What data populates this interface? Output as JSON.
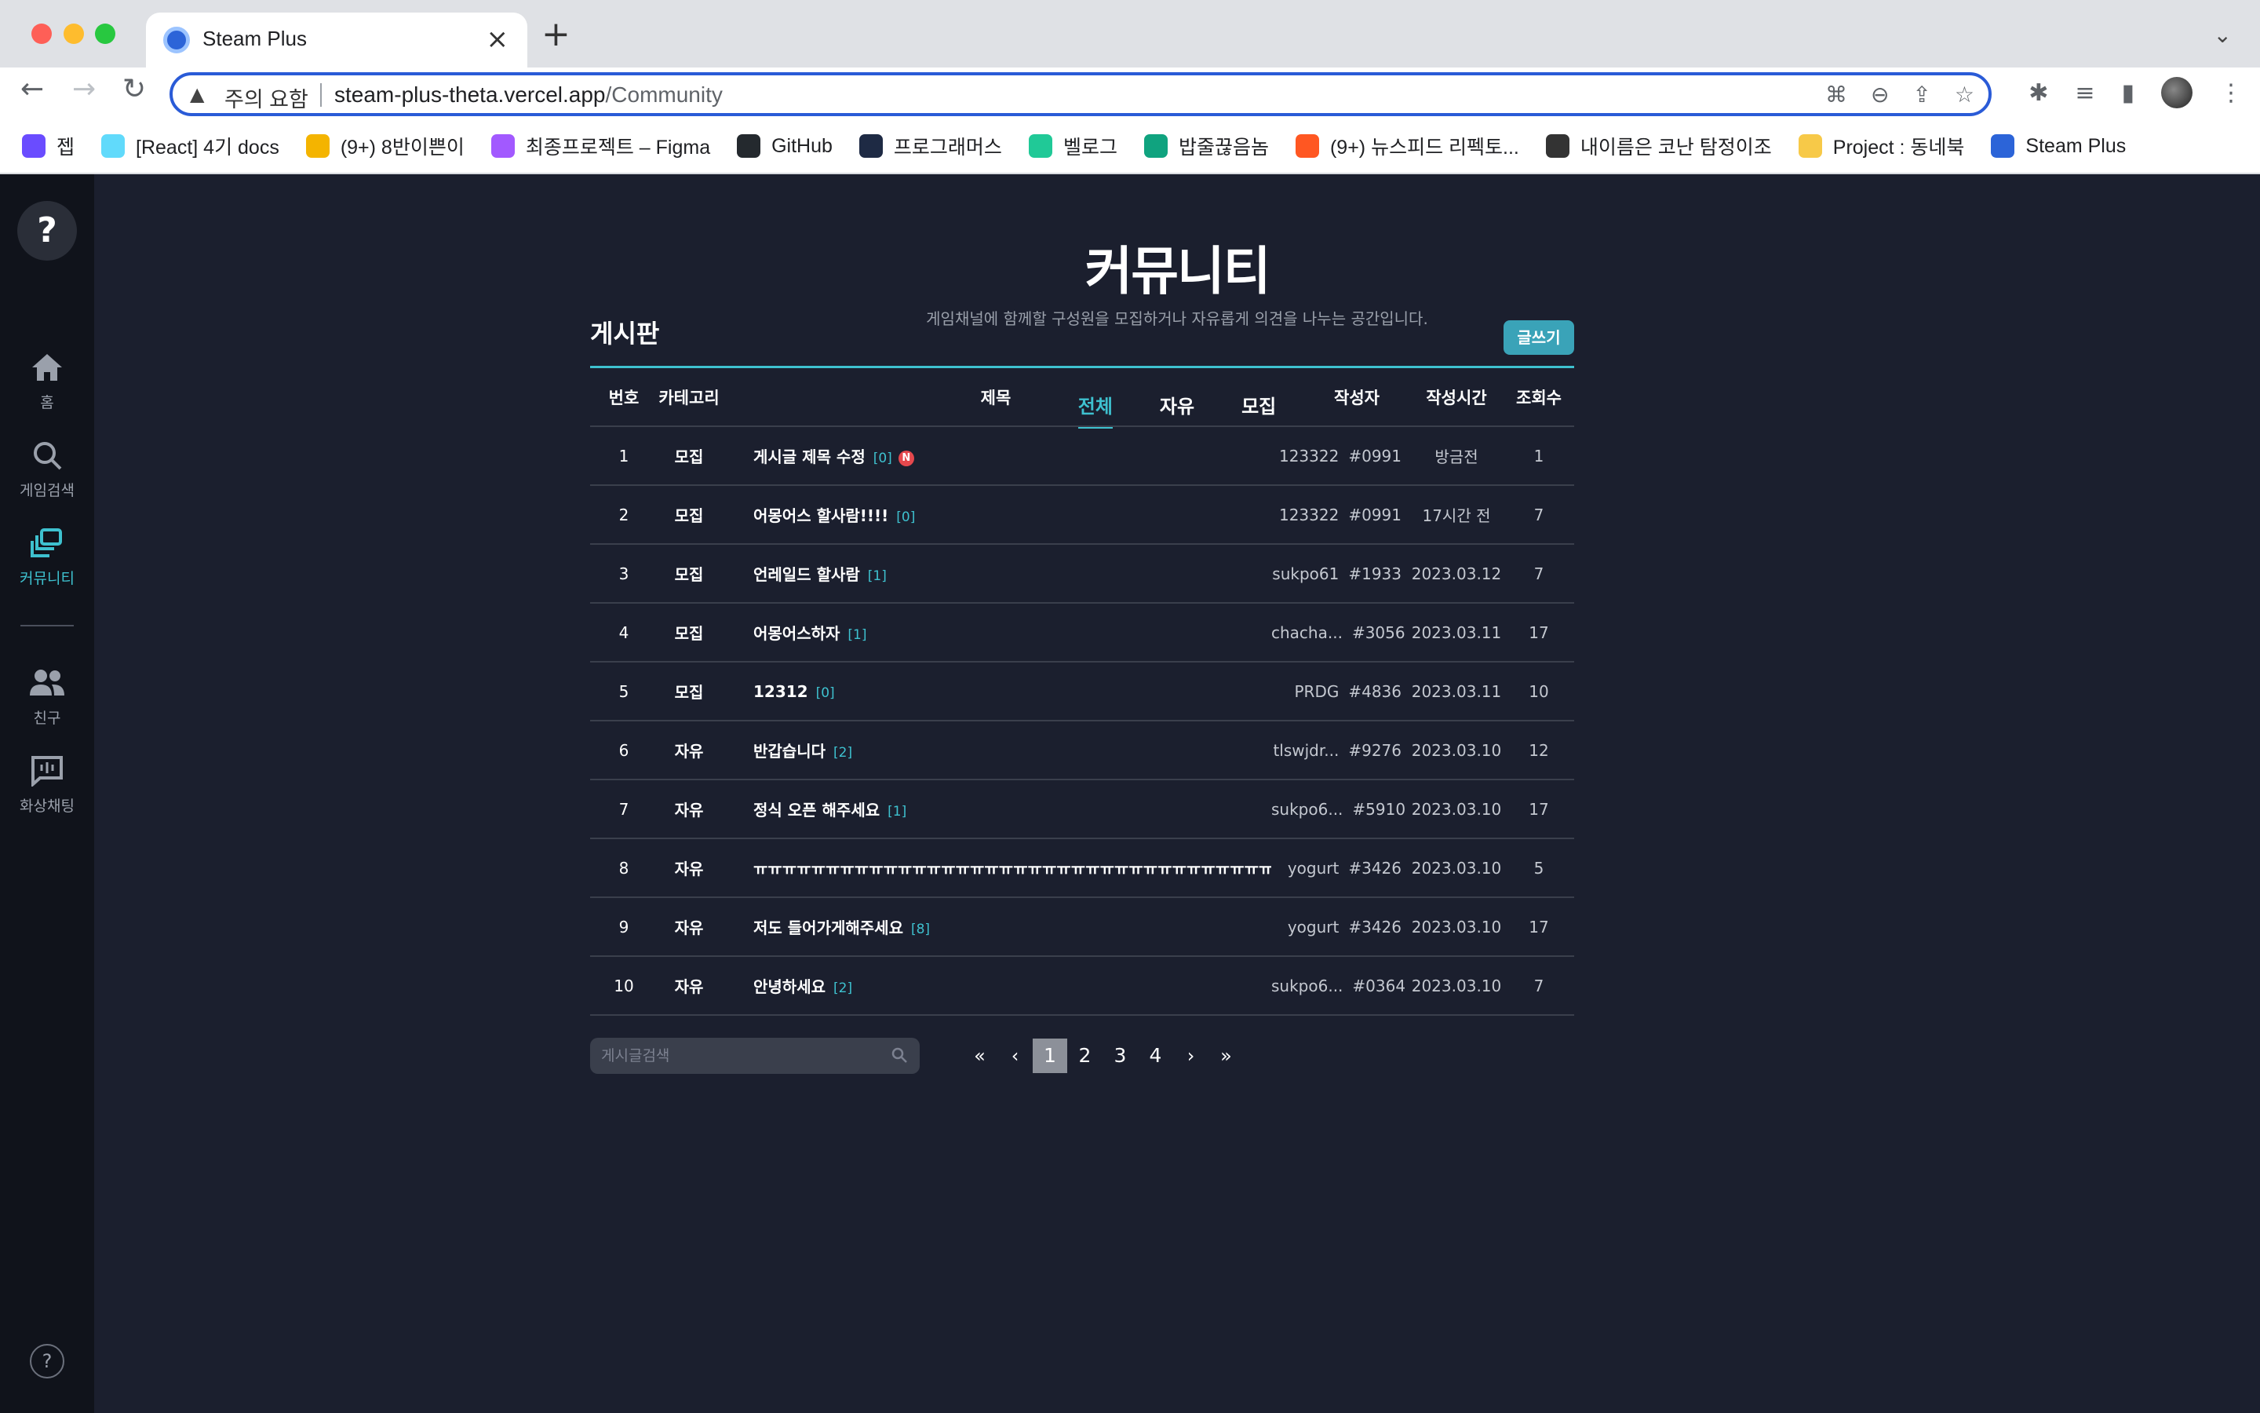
{
  "browser": {
    "tab_title": "Steam Plus",
    "security_warning": "주의 요함",
    "url_domain": "steam-plus-theta.vercel.app",
    "url_path": "/Community",
    "bookmarks": [
      {
        "label": "젭",
        "color": "#6a4cff",
        "icon": "zep-icon"
      },
      {
        "label": "[React] 4기 docs",
        "color": "#61dafb",
        "icon": "react-icon"
      },
      {
        "label": "(9+) 8반이쁜이",
        "color": "#f4b400",
        "icon": "emoji-icon"
      },
      {
        "label": "최종프로젝트 – Figma",
        "color": "#a259ff",
        "icon": "figma-icon"
      },
      {
        "label": "GitHub",
        "color": "#24292e",
        "icon": "github-icon"
      },
      {
        "label": "프로그래머스",
        "color": "#1e2a44",
        "icon": "programmers-icon"
      },
      {
        "label": "벨로그",
        "color": "#20c997",
        "icon": "velog-icon"
      },
      {
        "label": "밥줄끊음놈",
        "color": "#10a37f",
        "icon": "chatgpt-icon"
      },
      {
        "label": "(9+) 뉴스피드 리펙토...",
        "color": "#ff5722",
        "icon": "fire-icon"
      },
      {
        "label": "내이름은 코난 탐정이조",
        "color": "#333333",
        "icon": "watch-icon"
      },
      {
        "label": "Project : 동네북",
        "color": "#f7c948",
        "icon": "banana-icon"
      },
      {
        "label": "Steam Plus",
        "color": "#2c64d8",
        "icon": "steam-plus-icon"
      }
    ]
  },
  "sidebar": {
    "items": [
      {
        "label": "홈",
        "icon": "home-icon"
      },
      {
        "label": "게임검색",
        "icon": "search-icon"
      },
      {
        "label": "커뮤니티",
        "icon": "community-icon",
        "active": true
      },
      {
        "label": "친구",
        "icon": "friends-icon"
      },
      {
        "label": "화상채팅",
        "icon": "video-chat-icon"
      }
    ],
    "help": "?"
  },
  "page": {
    "title": "커뮤니티",
    "description": "게임채널에 함께할 구성원을 모집하거나 자유롭게 의견을 나누는 공간입니다.",
    "tabs": [
      "전체",
      "자유",
      "모집"
    ],
    "active_tab": "전체"
  },
  "board": {
    "title": "게시판",
    "write_label": "글쓰기",
    "columns": [
      "번호",
      "카테고리",
      "제목",
      "작성자",
      "작성시간",
      "조회수"
    ],
    "rows": [
      {
        "no": "1",
        "category": "모집",
        "title": "게시글 제목 수정",
        "comments": "[0]",
        "new": "N",
        "author": "123322",
        "tag": "#0991",
        "time": "방금전",
        "views": "1"
      },
      {
        "no": "2",
        "category": "모집",
        "title": "어몽어스 할사람!!!!",
        "comments": "[0]",
        "author": "123322",
        "tag": "#0991",
        "time": "17시간 전",
        "views": "7"
      },
      {
        "no": "3",
        "category": "모집",
        "title": "언레일드 할사람",
        "comments": "[1]",
        "author": "sukpo61",
        "tag": "#1933",
        "time": "2023.03.12",
        "views": "7"
      },
      {
        "no": "4",
        "category": "모집",
        "title": "어몽어스하자",
        "comments": "[1]",
        "author": "chacha...",
        "tag": "#3056",
        "time": "2023.03.11",
        "views": "17"
      },
      {
        "no": "5",
        "category": "모집",
        "title": "12312",
        "comments": "[0]",
        "author": "PRDG",
        "tag": "#4836",
        "time": "2023.03.11",
        "views": "10"
      },
      {
        "no": "6",
        "category": "자유",
        "title": "반갑습니다",
        "comments": "[2]",
        "author": "tlswjdr...",
        "tag": "#9276",
        "time": "2023.03.10",
        "views": "12"
      },
      {
        "no": "7",
        "category": "자유",
        "title": "정식 오픈 해주세요",
        "comments": "[1]",
        "author": "sukpo6...",
        "tag": "#5910",
        "time": "2023.03.10",
        "views": "17"
      },
      {
        "no": "8",
        "category": "자유",
        "title": "ㅠㅠㅠㅠㅠㅠㅠㅠㅠㅠㅠㅠㅠㅠㅠㅠㅠㅠㅠㅠㅠㅠㅠㅠㅠㅠㅠㅠㅠㅠㅠㅠㅠㅠㅠㅠ",
        "comments": "[0]",
        "author": "yogurt",
        "tag": "#3426",
        "time": "2023.03.10",
        "views": "5"
      },
      {
        "no": "9",
        "category": "자유",
        "title": "저도 들어가게해주세요",
        "comments": "[8]",
        "author": "yogurt",
        "tag": "#3426",
        "time": "2023.03.10",
        "views": "17"
      },
      {
        "no": "10",
        "category": "자유",
        "title": "안녕하세요",
        "comments": "[2]",
        "author": "sukpo6...",
        "tag": "#0364",
        "time": "2023.03.10",
        "views": "7"
      }
    ]
  },
  "search": {
    "placeholder": "게시글검색"
  },
  "pagination": {
    "first": "«",
    "prev": "‹",
    "next": "›",
    "last": "»",
    "pages": [
      "1",
      "2",
      "3",
      "4"
    ],
    "current": "1"
  },
  "colors": {
    "accent": "#3ec1cf",
    "background": "#1b1f2e",
    "sidebar": "#10131b",
    "new_badge": "#e5484d"
  }
}
